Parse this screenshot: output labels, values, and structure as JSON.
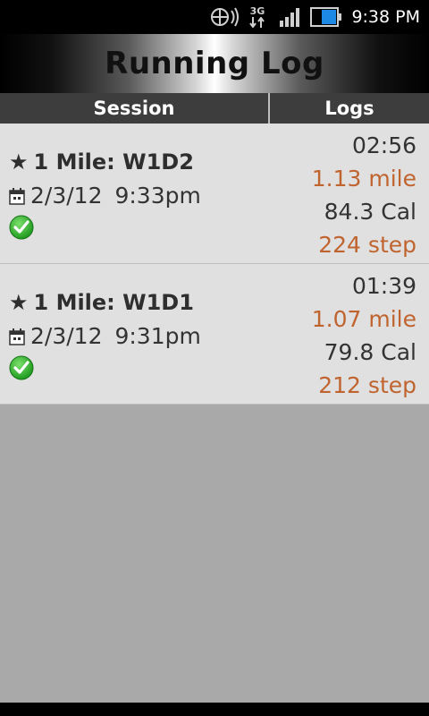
{
  "status_bar": {
    "time": "9:38 PM",
    "network_label": "3G",
    "icons": [
      "sync-icon",
      "network-3g-icon",
      "signal-icon",
      "battery-icon"
    ]
  },
  "header": {
    "title": "Running Log"
  },
  "columns": {
    "session": "Session",
    "logs": "Logs"
  },
  "sessions": [
    {
      "star": "★",
      "name": "1 Mile: W1D2",
      "date": "2/3/12",
      "time": "9:33pm",
      "duration": "02:56",
      "distance": "1.13 mile",
      "calories": "84.3 Cal",
      "steps": "224 step",
      "status_icon": "check-icon"
    },
    {
      "star": "★",
      "name": "1 Mile: W1D1",
      "date": "2/3/12",
      "time": "9:31pm",
      "duration": "01:39",
      "distance": "1.07 mile",
      "calories": "79.8 Cal",
      "steps": "212 step",
      "status_icon": "check-icon"
    }
  ],
  "colors": {
    "accent_orange": "#c0642f",
    "row_background": "#e0e0e0",
    "list_background": "#a9a9a9",
    "header_bar": "#3d3d3d"
  }
}
